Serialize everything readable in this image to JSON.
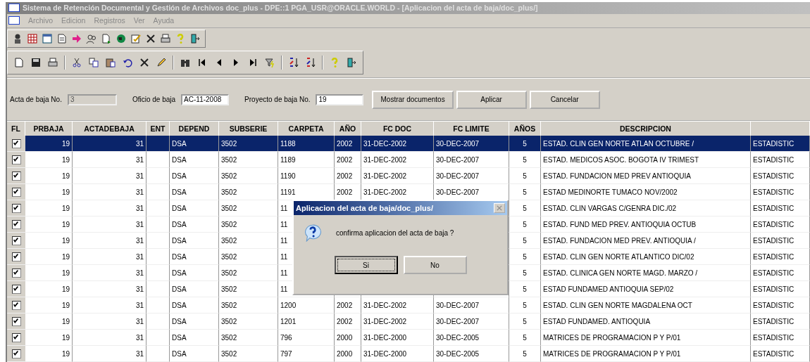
{
  "window": {
    "title": "Sistema de Retención Documental y Gestión de Archivos doc_plus - DPE::1  PGA_USR@ORACLE.WORLD - [Aplicacion del acta de baja/doc_plus/]"
  },
  "menu": [
    "Archivo",
    "Edicion",
    "Registros",
    "Ver",
    "Ayuda"
  ],
  "form": {
    "fields": [
      {
        "label": "Acta de baja No.",
        "value": "3",
        "disabled": true
      },
      {
        "label": "Oficio de baja",
        "value": "AC-11-2008",
        "disabled": false
      },
      {
        "label": "Proyecto de baja No.",
        "value": "19",
        "disabled": false
      }
    ],
    "buttons": [
      "Mostrar documentos",
      "Aplicar",
      "Cancelar"
    ]
  },
  "table": {
    "columns": [
      "FL",
      "PRBAJA",
      "ACTADEBAJA",
      "ENT",
      "DEPEND",
      "SUBSERIE",
      "CARPETA",
      "AÑO",
      "FC DOC",
      "FC LIMITE",
      "AÑOS",
      "DESCRIPCION"
    ],
    "rows": [
      {
        "selected": true,
        "cells": [
          {
            "checked": true
          },
          "19",
          "31",
          null,
          "DSA",
          "3502",
          "1188",
          "2002",
          "31-DEC-2002",
          "30-DEC-2007",
          "5",
          "ESTAD. CLIN GEN NORTE ATLAN OCTUBRE /",
          "ESTADISTIC"
        ]
      },
      {
        "selected": false,
        "cells": [
          {
            "checked": true
          },
          "19",
          "31",
          null,
          "DSA",
          "3502",
          "1189",
          "2002",
          "31-DEC-2002",
          "30-DEC-2007",
          "5",
          "ESTAD. MEDICOS ASOC. BOGOTA IV TRIMEST",
          "ESTADISTIC"
        ]
      },
      {
        "selected": false,
        "cells": [
          {
            "checked": true
          },
          "19",
          "31",
          null,
          "DSA",
          "3502",
          "1190",
          "2002",
          "31-DEC-2002",
          "30-DEC-2007",
          "5",
          "ESTAD. FUNDACION MED PREV ANTIOQUIA",
          "ESTADISTIC"
        ]
      },
      {
        "selected": false,
        "cells": [
          {
            "checked": true
          },
          "19",
          "31",
          null,
          "DSA",
          "3502",
          "1191",
          "2002",
          "31-DEC-2002",
          "30-DEC-2007",
          "5",
          "ESTAD MEDINORTE TUMACO NOV/2002",
          "ESTADISTIC"
        ]
      },
      {
        "selected": false,
        "cells": [
          {
            "checked": true
          },
          "19",
          "31",
          null,
          "DSA",
          "3502",
          "11",
          null,
          null,
          null,
          "5",
          "ESTAD. CLIN VARGAS C/GENRA DIC./02",
          "ESTADISTIC"
        ]
      },
      {
        "selected": false,
        "cells": [
          {
            "checked": true
          },
          "19",
          "31",
          null,
          "DSA",
          "3502",
          "11",
          null,
          null,
          null,
          "5",
          "ESTAD. FUND MED PREV. ANTIOQUIA OCTUB",
          "ESTADISTIC"
        ]
      },
      {
        "selected": false,
        "cells": [
          {
            "checked": true
          },
          "19",
          "31",
          null,
          "DSA",
          "3502",
          "11",
          null,
          null,
          null,
          "5",
          "ESTAD. FUNDACION MED PREV. ANTIOQUIA /",
          "ESTADISTIC"
        ]
      },
      {
        "selected": false,
        "cells": [
          {
            "checked": true
          },
          "19",
          "31",
          null,
          "DSA",
          "3502",
          "11",
          null,
          null,
          null,
          "5",
          "ESTAD. CLIN GEN NORTE ATLANTICO DIC/02",
          "ESTADISTIC"
        ]
      },
      {
        "selected": false,
        "cells": [
          {
            "checked": true
          },
          "19",
          "31",
          null,
          "DSA",
          "3502",
          "11",
          null,
          null,
          null,
          "5",
          "ESTAD. CLINICA GEN NORTE MAGD. MARZO /",
          "ESTADISTIC"
        ]
      },
      {
        "selected": false,
        "cells": [
          {
            "checked": true
          },
          "19",
          "31",
          null,
          "DSA",
          "3502",
          "11",
          null,
          null,
          null,
          "5",
          "ESTAD FUNDAMED ANTIOQUIA SEP/02",
          "ESTADISTIC"
        ]
      },
      {
        "selected": false,
        "cells": [
          {
            "checked": true
          },
          "19",
          "31",
          null,
          "DSA",
          "3502",
          "1200",
          "2002",
          "31-DEC-2002",
          "30-DEC-2007",
          "5",
          "ESTAD.  CLIN GEN NORTE MAGDALENA  OCT",
          "ESTADISTIC"
        ]
      },
      {
        "selected": false,
        "cells": [
          {
            "checked": true
          },
          "19",
          "31",
          null,
          "DSA",
          "3502",
          "1201",
          "2002",
          "31-DEC-2002",
          "30-DEC-2007",
          "5",
          "ESTAD FUNDAMED. ANTIOQUIA",
          "ESTADISTIC"
        ]
      },
      {
        "selected": false,
        "cells": [
          {
            "checked": true
          },
          "19",
          "31",
          null,
          "DSA",
          "3502",
          "796",
          "2000",
          "31-DEC-2000",
          "30-DEC-2005",
          "5",
          "MATRICES DE PROGRAMACION  P Y P/01",
          "ESTADISTIC"
        ]
      },
      {
        "selected": false,
        "cells": [
          {
            "checked": true
          },
          "19",
          "31",
          null,
          "DSA",
          "3502",
          "797",
          "2000",
          "31-DEC-2000",
          "30-DEC-2005",
          "5",
          "MATRICES DE PROGRAMACION  P Y P/01",
          "ESTADISTIC"
        ]
      }
    ]
  },
  "dialog": {
    "title": "Aplicacion del acta de baja/doc_plus/",
    "message": "confirma aplicacion del acta de baja ?",
    "buttons": [
      {
        "label": "Si",
        "focused": true
      },
      {
        "label": "No",
        "focused": false
      }
    ]
  }
}
